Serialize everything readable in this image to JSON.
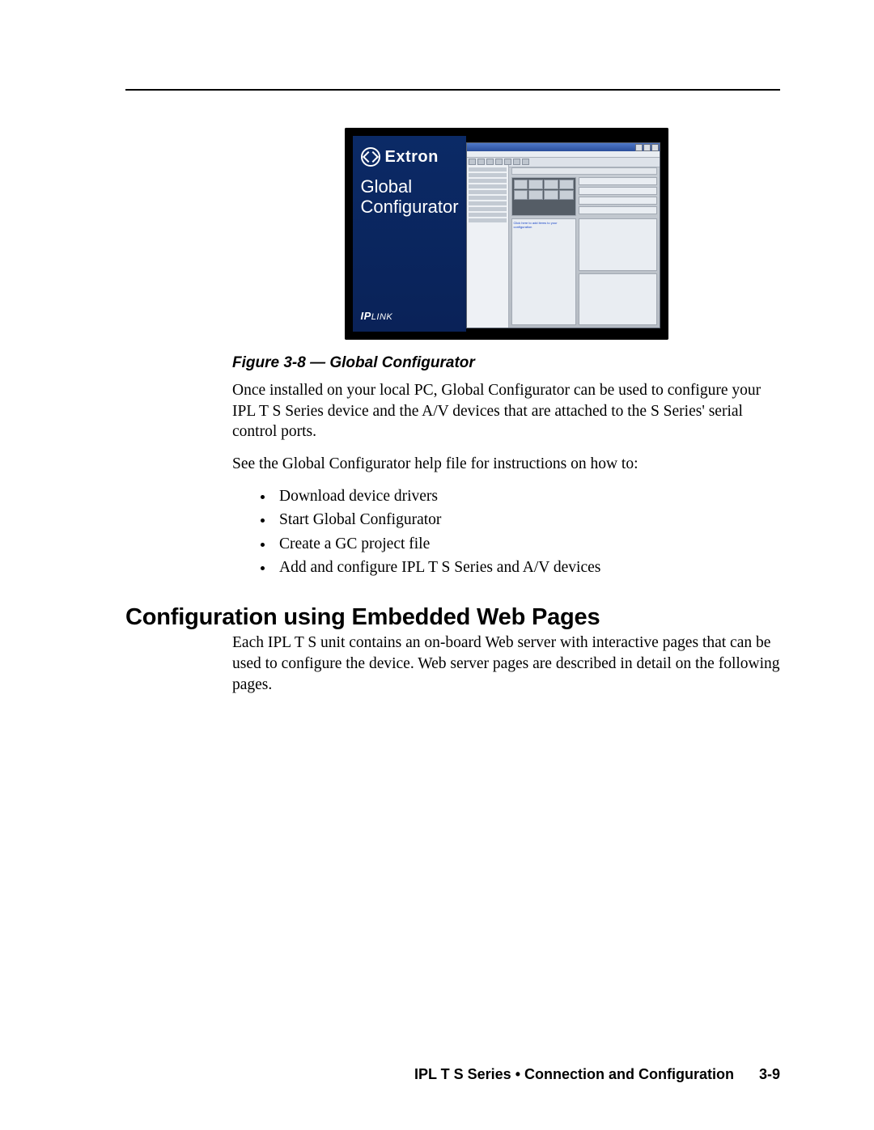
{
  "figure": {
    "brand": "Extron",
    "title_line1": "Global",
    "title_line2": "Configurator",
    "sub_brand_prefix": "IP",
    "sub_brand_suffix": "LINK",
    "caption": "Figure 3-8 — Global Configurator"
  },
  "paragraphs": {
    "p1": "Once installed on your local PC, Global Configurator can be used to configure your IPL T S Series device and the A/V devices that are attached to the S Series' serial control ports.",
    "p2": "See the Global Configurator help file for instructions on how to:"
  },
  "bullets": [
    "Download device drivers",
    "Start Global Configurator",
    "Create a GC project file",
    "Add and configure IPL T S Series and A/V devices"
  ],
  "section_heading": "Configuration using Embedded Web Pages",
  "paragraphs2": {
    "p3": "Each IPL T S unit contains an on-board Web server with interactive pages that can be used to configure the device.  Web server pages are described in detail on the following pages."
  },
  "footer": {
    "text": "IPL T S Series • Connection and Configuration",
    "page": "3-9"
  }
}
